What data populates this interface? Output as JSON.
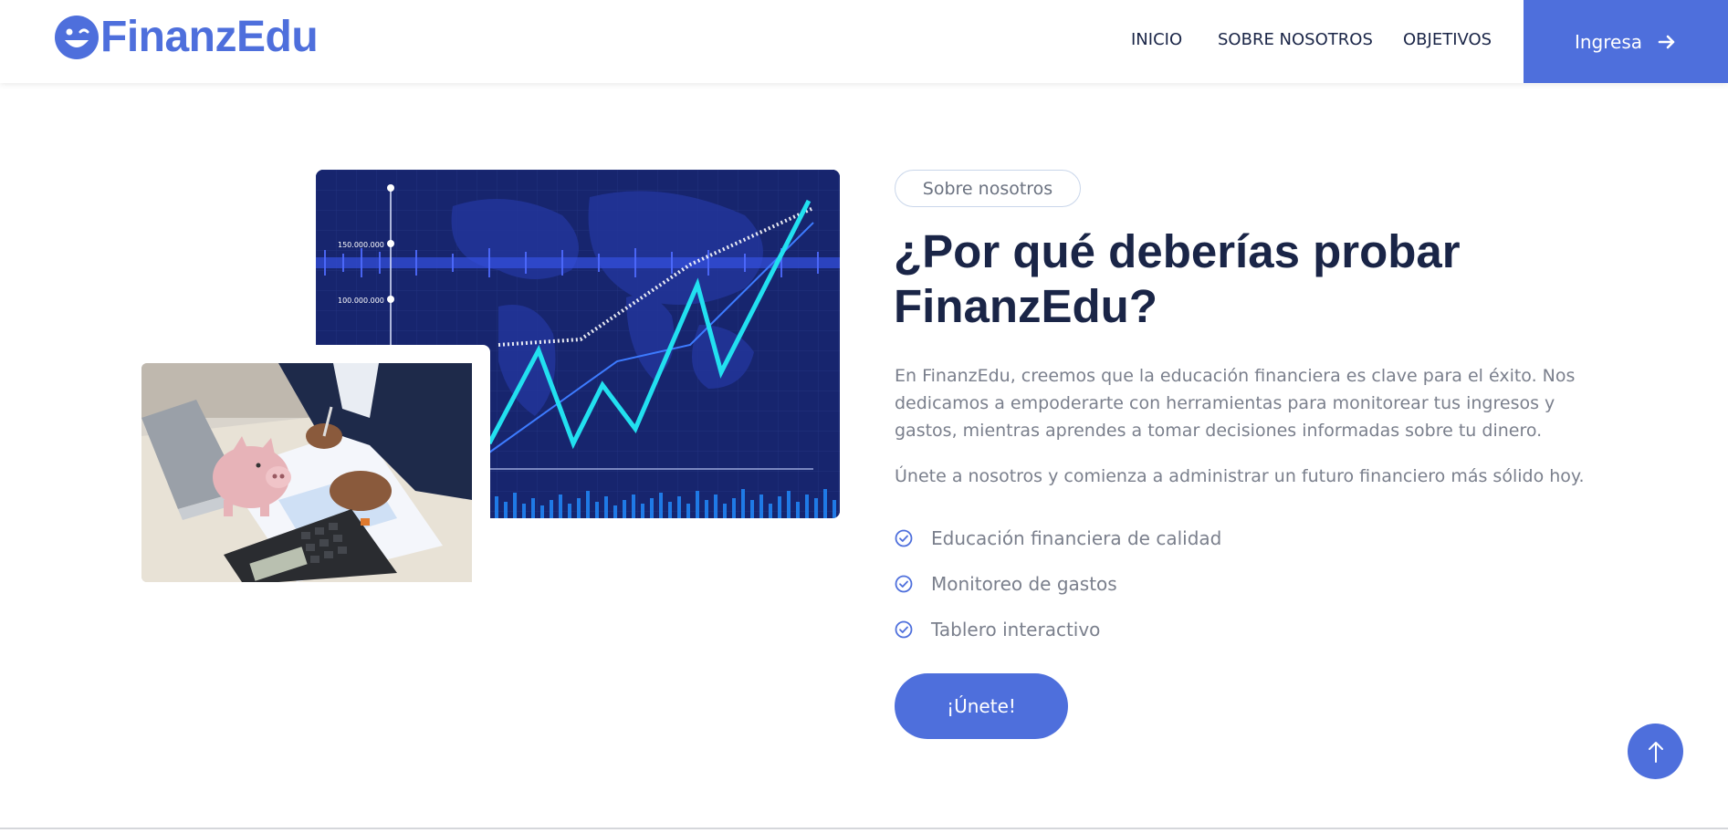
{
  "header": {
    "brand": "FinanzEdu",
    "logo_icon": "smiley-wink-icon",
    "nav": [
      {
        "label": "INICIO"
      },
      {
        "label": "SOBRE NOSOTROS"
      },
      {
        "label": "OBJETIVOS"
      }
    ],
    "cta_label": "Ingresa",
    "cta_icon": "arrow-right-icon"
  },
  "hero_image": {
    "chart_labels": [
      "150.000.000",
      "100.000.000"
    ]
  },
  "about": {
    "tag": "Sobre nosotros",
    "title": "¿Por qué deberías probar FinanzEdu?",
    "paragraph_1": "En FinanzEdu, creemos que la educación financiera es clave para el éxito. Nos dedicamos a empoderarte con herramientas para monitorear tus ingresos y gastos, mientras aprendes a tomar decisiones informadas sobre tu dinero.",
    "paragraph_2": "Únete a nosotros y comienza a administrar un futuro financiero más sólido hoy.",
    "features": [
      {
        "label": "Educación financiera de calidad"
      },
      {
        "label": "Monitoreo de gastos"
      },
      {
        "label": "Tablero interactivo"
      }
    ],
    "join_label": "¡Únete!"
  },
  "colors": {
    "accent": "#4e6fdc",
    "heading": "#1a2547",
    "body_text": "#7a7f8c"
  }
}
